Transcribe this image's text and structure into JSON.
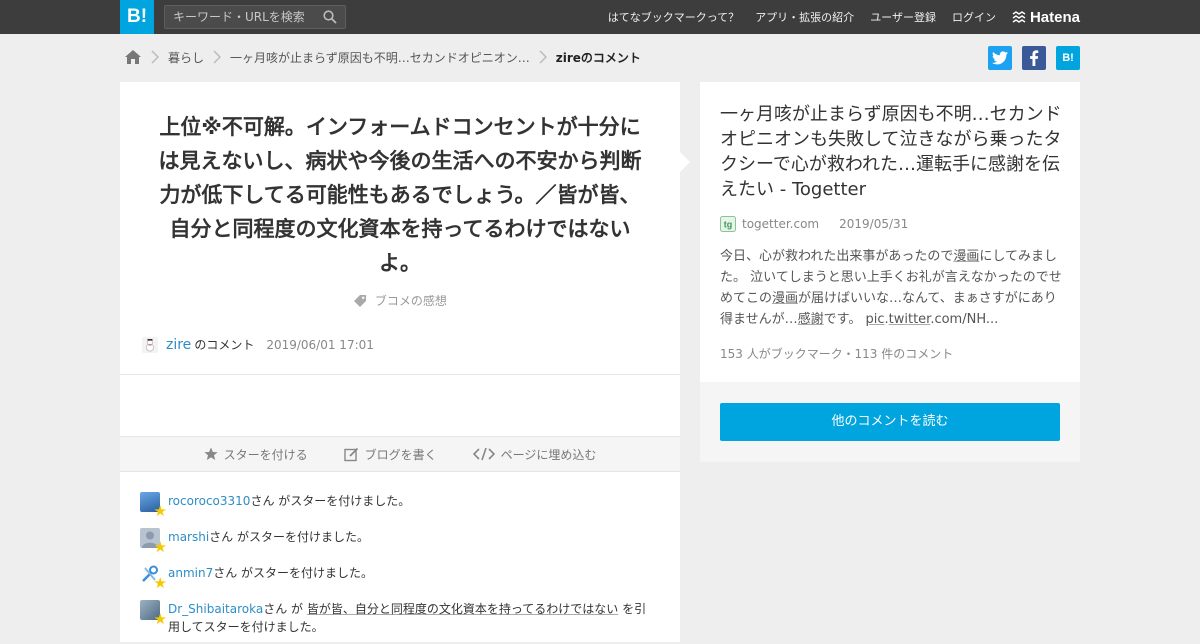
{
  "header": {
    "logo_text": "B!",
    "search_placeholder": "キーワード・URLを検索",
    "nav": [
      "はてなブックマークって？",
      "アプリ・拡張の紹介",
      "ユーザー登録",
      "ログイン"
    ],
    "brand": "Hatena"
  },
  "breadcrumb": {
    "items": [
      "暮らし",
      "一ヶ月咳が止まらず原因も不明…セカンドオピニオン…"
    ],
    "current": "zireのコメント"
  },
  "share": {
    "twitter": "t",
    "facebook": "f",
    "hatena": "B!"
  },
  "comment": {
    "text": "上位※不可解。インフォームドコンセントが十分には見えないし、病状や今後の生活への不安から判断力が低下してる可能性もあるでしょう。／皆が皆、自分と同程度の文化資本を持ってるわけではないよ。",
    "tag": "ブコメの感想",
    "author": "zire",
    "author_suffix": "のコメント",
    "date": "2019/06/01 17:01"
  },
  "actions": {
    "star": "スターを付ける",
    "blog": "ブログを書く",
    "embed": "ページに埋め込む"
  },
  "stars": [
    {
      "user": "rocoroco3310",
      "pre": "さん がスターを付けました。",
      "quote": "",
      "post": ""
    },
    {
      "user": "marshi",
      "pre": "さん がスターを付けました。",
      "quote": "",
      "post": ""
    },
    {
      "user": "anmin7",
      "pre": "さん がスターを付けました。",
      "quote": "",
      "post": ""
    },
    {
      "user": "Dr_Shibaitaroka",
      "pre": "さん が ",
      "quote": "皆が皆、自分と同程度の文化資本を持ってるわけではない",
      "post": " を引用してスターを付けました。"
    }
  ],
  "entry": {
    "title": "一ヶ月咳が止まらず原因も不明…セカンドオピニオンも失敗して泣きながら乗ったタクシーで心が救われた…運転手に感謝を伝えたい - Togetter",
    "domain": "togetter.com",
    "date": "2019/05/31",
    "desc_1": "今日、心が救われた出来事があったので",
    "desc_manga1": "漫画",
    "desc_2": "にしてみました。 泣いてしまうと思い上手くお礼が言えなかったのでせめてこの",
    "desc_manga2": "漫画",
    "desc_3": "が届けばいいな…なんて、まぁさすがにあり得ませんが…",
    "desc_thanks": "感謝",
    "desc_4": "です。 ",
    "desc_pic": "pic",
    "desc_5": ".",
    "desc_twitter": "twitter",
    "desc_6": ".com/NH...",
    "stats": "153 人がブックマーク・113 件のコメント",
    "read_more": "他のコメントを読む"
  },
  "colors": {
    "accent": "#00a4de",
    "header_bg": "#3d3d3d",
    "link": "#2d8ec7",
    "star": "#f5c900"
  }
}
